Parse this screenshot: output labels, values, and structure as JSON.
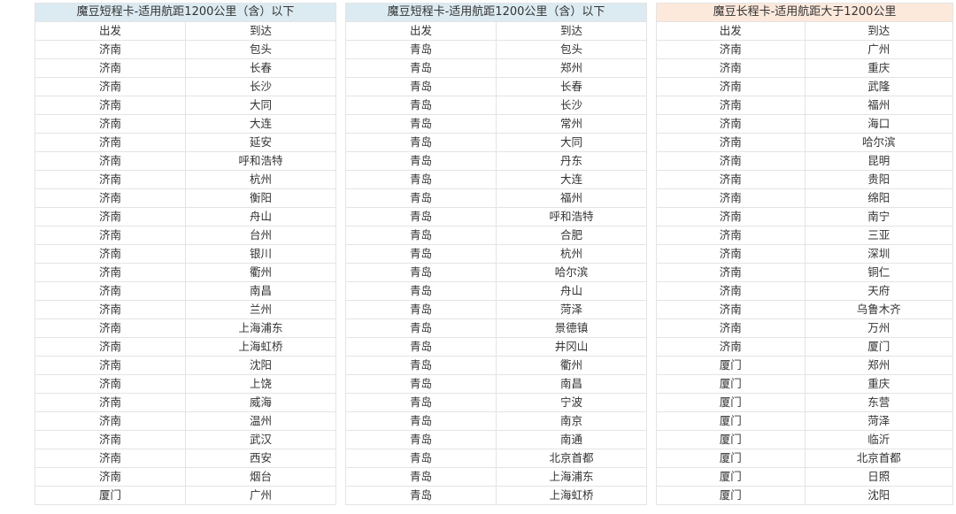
{
  "tables": [
    {
      "title": "魔豆短程卡-适用航距1200公里（含）以下",
      "header_color": "#dcebf2",
      "columns": [
        "出发",
        "到达"
      ],
      "rows": [
        [
          "济南",
          "包头"
        ],
        [
          "济南",
          "长春"
        ],
        [
          "济南",
          "长沙"
        ],
        [
          "济南",
          "大同"
        ],
        [
          "济南",
          "大连"
        ],
        [
          "济南",
          "延安"
        ],
        [
          "济南",
          "呼和浩特"
        ],
        [
          "济南",
          "杭州"
        ],
        [
          "济南",
          "衡阳"
        ],
        [
          "济南",
          "舟山"
        ],
        [
          "济南",
          "台州"
        ],
        [
          "济南",
          "银川"
        ],
        [
          "济南",
          "衢州"
        ],
        [
          "济南",
          "南昌"
        ],
        [
          "济南",
          "兰州"
        ],
        [
          "济南",
          "上海浦东"
        ],
        [
          "济南",
          "上海虹桥"
        ],
        [
          "济南",
          "沈阳"
        ],
        [
          "济南",
          "上饶"
        ],
        [
          "济南",
          "威海"
        ],
        [
          "济南",
          "温州"
        ],
        [
          "济南",
          "武汉"
        ],
        [
          "济南",
          "西安"
        ],
        [
          "济南",
          "烟台"
        ],
        [
          "厦门",
          "广州"
        ]
      ]
    },
    {
      "title": "魔豆短程卡-适用航距1200公里（含）以下",
      "header_color": "#dcebf2",
      "columns": [
        "出发",
        "到达"
      ],
      "rows": [
        [
          "青岛",
          "包头"
        ],
        [
          "青岛",
          "郑州"
        ],
        [
          "青岛",
          "长春"
        ],
        [
          "青岛",
          "长沙"
        ],
        [
          "青岛",
          "常州"
        ],
        [
          "青岛",
          "大同"
        ],
        [
          "青岛",
          "丹东"
        ],
        [
          "青岛",
          "大连"
        ],
        [
          "青岛",
          "福州"
        ],
        [
          "青岛",
          "呼和浩特"
        ],
        [
          "青岛",
          "合肥"
        ],
        [
          "青岛",
          "杭州"
        ],
        [
          "青岛",
          "哈尔滨"
        ],
        [
          "青岛",
          "舟山"
        ],
        [
          "青岛",
          "菏泽"
        ],
        [
          "青岛",
          "景德镇"
        ],
        [
          "青岛",
          "井冈山"
        ],
        [
          "青岛",
          "衢州"
        ],
        [
          "青岛",
          "南昌"
        ],
        [
          "青岛",
          "宁波"
        ],
        [
          "青岛",
          "南京"
        ],
        [
          "青岛",
          "南通"
        ],
        [
          "青岛",
          "北京首都"
        ],
        [
          "青岛",
          "上海浦东"
        ],
        [
          "青岛",
          "上海虹桥"
        ]
      ]
    },
    {
      "title": "魔豆长程卡-适用航距大于1200公里",
      "header_color": "#fde9dc",
      "columns": [
        "出发",
        "到达"
      ],
      "rows": [
        [
          "济南",
          "广州"
        ],
        [
          "济南",
          "重庆"
        ],
        [
          "济南",
          "武隆"
        ],
        [
          "济南",
          "福州"
        ],
        [
          "济南",
          "海口"
        ],
        [
          "济南",
          "哈尔滨"
        ],
        [
          "济南",
          "昆明"
        ],
        [
          "济南",
          "贵阳"
        ],
        [
          "济南",
          "绵阳"
        ],
        [
          "济南",
          "南宁"
        ],
        [
          "济南",
          "三亚"
        ],
        [
          "济南",
          "深圳"
        ],
        [
          "济南",
          "铜仁"
        ],
        [
          "济南",
          "天府"
        ],
        [
          "济南",
          "乌鲁木齐"
        ],
        [
          "济南",
          "万州"
        ],
        [
          "济南",
          "厦门"
        ],
        [
          "厦门",
          "郑州"
        ],
        [
          "厦门",
          "重庆"
        ],
        [
          "厦门",
          "东营"
        ],
        [
          "厦门",
          "菏泽"
        ],
        [
          "厦门",
          "临沂"
        ],
        [
          "厦门",
          "北京首都"
        ],
        [
          "厦门",
          "日照"
        ],
        [
          "厦门",
          "沈阳"
        ]
      ]
    }
  ]
}
